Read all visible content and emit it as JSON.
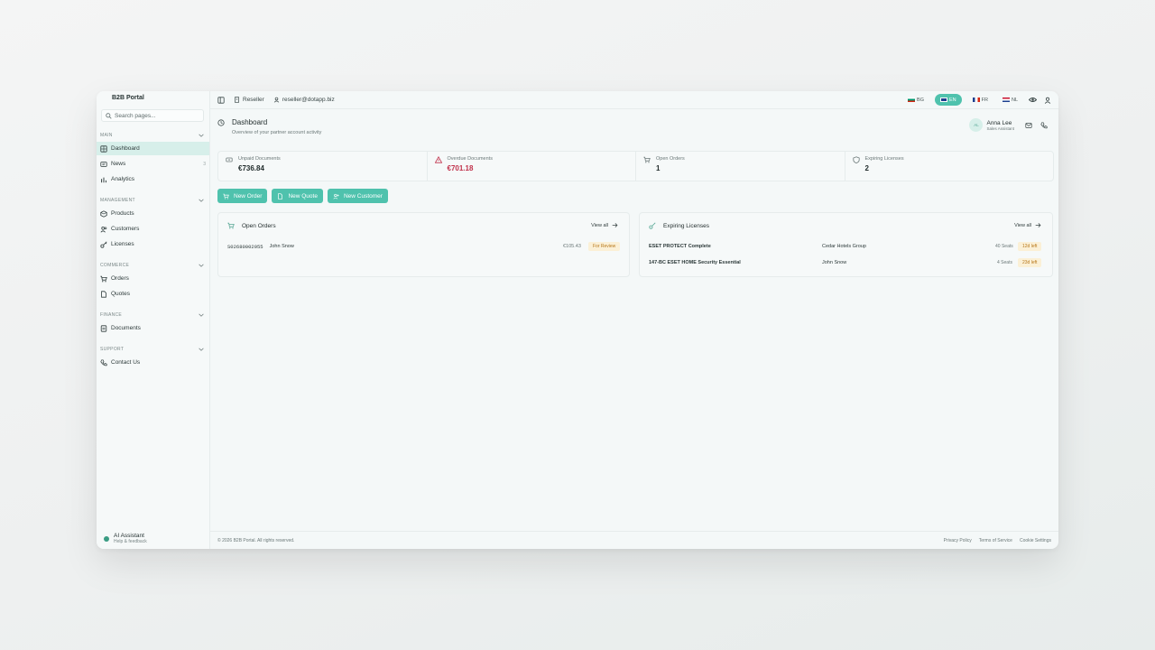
{
  "app": {
    "title": "B2B Portal"
  },
  "search": {
    "placeholder": "Search pages..."
  },
  "sidebar": {
    "sections": [
      {
        "label": "MAIN",
        "items": [
          {
            "label": "Dashboard",
            "active": true
          },
          {
            "label": "News",
            "count": "3"
          },
          {
            "label": "Analytics"
          }
        ]
      },
      {
        "label": "MANAGEMENT",
        "items": [
          {
            "label": "Products"
          },
          {
            "label": "Customers"
          },
          {
            "label": "Licenses"
          }
        ]
      },
      {
        "label": "COMMERCE",
        "items": [
          {
            "label": "Orders"
          },
          {
            "label": "Quotes"
          }
        ]
      },
      {
        "label": "FINANCE",
        "items": [
          {
            "label": "Documents"
          }
        ]
      },
      {
        "label": "SUPPORT",
        "items": [
          {
            "label": "Contact Us"
          }
        ]
      }
    ],
    "ai": {
      "title": "AI Assistant",
      "subtitle": "Help & feedback"
    }
  },
  "topbar": {
    "role": "Reseller",
    "email": "reseller@dotapp.biz",
    "languages": [
      {
        "code": "BG"
      },
      {
        "code": "EN",
        "active": true
      },
      {
        "code": "FR"
      },
      {
        "code": "NL"
      }
    ]
  },
  "page": {
    "title": "Dashboard",
    "subtitle": "Overview of your partner account activity"
  },
  "user": {
    "initials": "AL",
    "name": "Anna Lee",
    "role": "Sales Assistant"
  },
  "stats": [
    {
      "label": "Unpaid Documents",
      "value": "€736.84"
    },
    {
      "label": "Overdue Documents",
      "value": "€701.18",
      "alert": true
    },
    {
      "label": "Open Orders",
      "value": "1"
    },
    {
      "label": "Expiring Licenses",
      "value": "2"
    }
  ],
  "actions": [
    {
      "label": "New Order"
    },
    {
      "label": "New Quote"
    },
    {
      "label": "New Customer"
    }
  ],
  "open_orders": {
    "title": "Open Orders",
    "view_all": "View all",
    "rows": [
      {
        "number": "S02680002955",
        "customer": "John Snow",
        "amount": "€105.43",
        "status": "For Review"
      }
    ]
  },
  "expiring_licenses": {
    "title": "Expiring Licenses",
    "view_all": "View all",
    "rows": [
      {
        "product": "ESET PROTECT Complete",
        "customer": "Cedar Hotels Group",
        "seats": "40 Seats",
        "left": "12d left"
      },
      {
        "product": "147-BC ESET HOME Security Essential",
        "customer": "John Snow",
        "seats": "4 Seats",
        "left": "23d left"
      }
    ]
  },
  "footer": {
    "copyright": "© 2026 B2B Portal. All rights reserved.",
    "links": [
      "Privacy Policy",
      "Terms of Service",
      "Cookie Settings"
    ]
  },
  "colors": {
    "accent": "#4fc2ad",
    "alert": "#c0304a",
    "badge_bg": "#fbf0d6",
    "badge_text": "#b7781b"
  },
  "icons": {
    "search": "search-icon",
    "dashboard": "grid-icon",
    "news": "newspaper-icon",
    "analytics": "chart-icon",
    "products": "box-icon",
    "customers": "users-icon",
    "licenses": "key-icon",
    "orders": "cart-icon",
    "quotes": "file-icon",
    "documents": "document-icon",
    "contact": "phone-icon"
  }
}
